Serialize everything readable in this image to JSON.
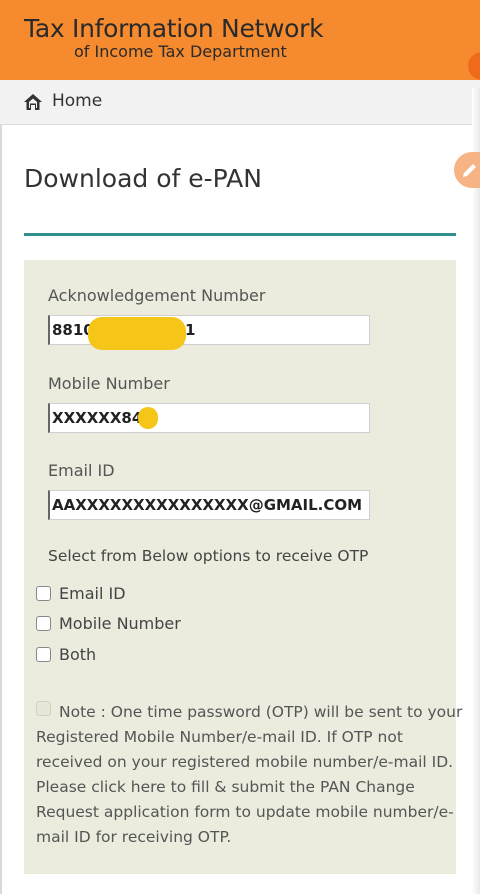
{
  "header": {
    "title": "Tax Information Network",
    "subtitle": "of Income Tax Department",
    "bg_color": "#f58a2e"
  },
  "breadcrumb": {
    "home_label": "Home",
    "icon": "home-icon"
  },
  "page": {
    "title": "Download of e-PAN",
    "rule_color": "#2f8f8a"
  },
  "form": {
    "ack_label": "Acknowledgement Number",
    "ack_prefix": "8810",
    "ack_suffix": "1",
    "mobile_label": "Mobile Number",
    "mobile_value": "XXXXXX846",
    "email_label": "Email ID",
    "email_value": "AAXXXXXXXXXXXXXXX@GMAIL.COM",
    "otp_heading": "Select from Below options to receive OTP",
    "otp_options": [
      "Email ID",
      "Mobile Number",
      "Both"
    ],
    "redaction_color": "#f5c518"
  },
  "note": {
    "lines": [
      "Note : One time password (OTP) will be sent to your",
      "Registered Mobile Number/e-mail ID. If OTP not",
      "received on your registered mobile number/e-mail ID.",
      "Please click here to fill & submit the PAN Change",
      "Request application form to update mobile number/e-",
      "mail ID for receiving OTP."
    ]
  }
}
